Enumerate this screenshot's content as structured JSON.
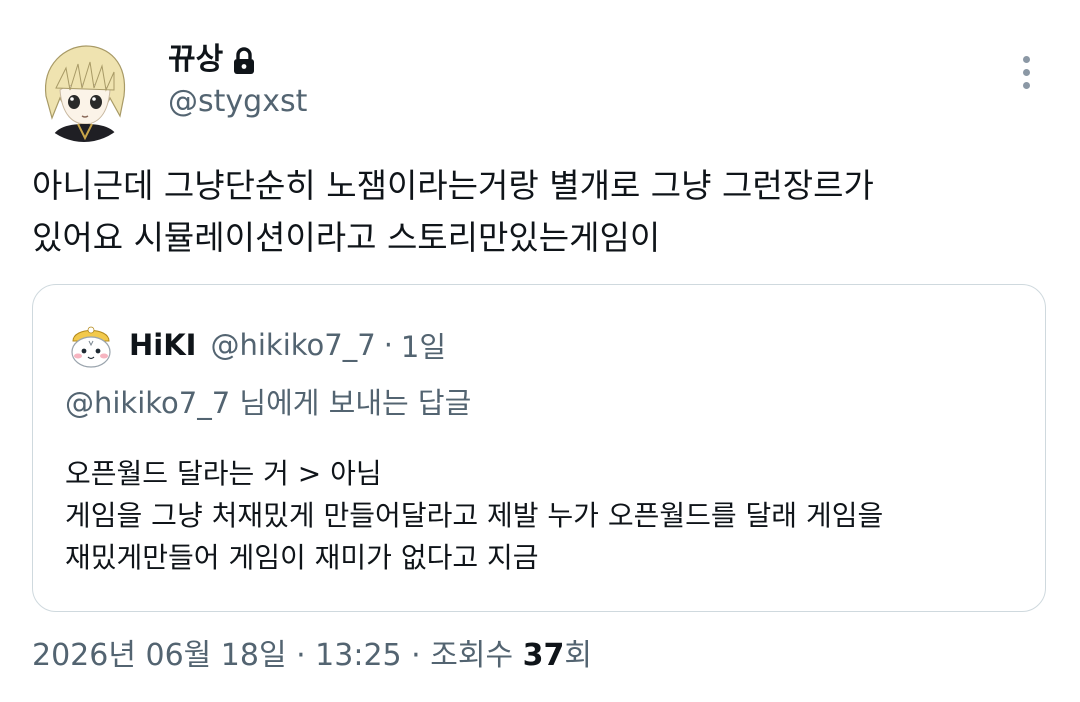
{
  "author": {
    "display_name": "뀨상",
    "handle": "@stygxst",
    "protected_icon": "lock-icon"
  },
  "tweet": {
    "lines": [
      "아니근데 그냥단순히 노잼이라는거랑 별개로 그냥 그런장르가",
      "있어요 시뮬레이션이라고 스토리만있는게임이"
    ]
  },
  "quote": {
    "display_name": "HiKI",
    "handle": "@hikiko7_7",
    "separator": "·",
    "time": "1일",
    "reply_to": "@hikiko7_7 님에게 보내는 답글",
    "lines": [
      "오픈월드 달라는 거 > 아님",
      "게임을 그냥 처재밌게 만들어달라고 제발 누가 오픈월드를 달래 게임을",
      "재밌게만들어 게임이 재미가 없다고 지금"
    ]
  },
  "meta": {
    "date_time": "2026년 06월 18일 · 13:25 · 조회수 ",
    "views_count": "37",
    "views_suffix": "회"
  },
  "colors": {
    "text_primary": "#0f1419",
    "text_secondary": "#536471",
    "border": "#cfd9de"
  }
}
